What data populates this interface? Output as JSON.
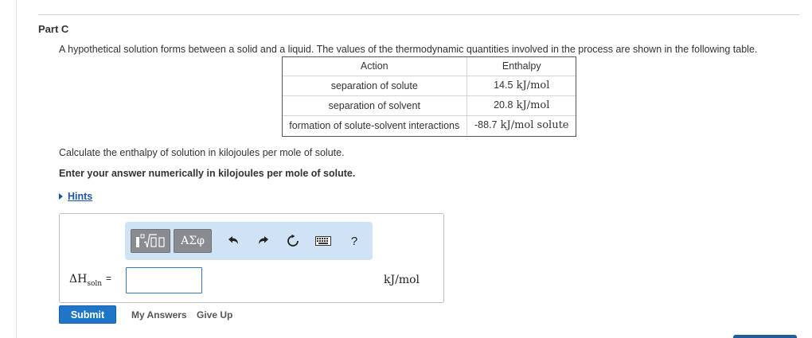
{
  "part": {
    "title": "Part C"
  },
  "problem": {
    "intro": "A hypothetical solution forms between a solid and a liquid. The values of the thermodynamic quantities involved in the process are shown in the following table.",
    "question": "Calculate the enthalpy of solution in kilojoules per mole of solute.",
    "instruction": "Enter your answer numerically in kilojoules per mole of solute."
  },
  "table": {
    "headers": {
      "action": "Action",
      "enthalpy": "Enthalpy"
    },
    "rows": [
      {
        "action": "separation of solute",
        "value": "14.5",
        "unit": "kJ/mol"
      },
      {
        "action": "separation of solvent",
        "value": "20.8",
        "unit": "kJ/mol"
      },
      {
        "action": "formation of solute-solvent interactions",
        "value": "-88.7",
        "unit": "kJ/mol solute"
      }
    ]
  },
  "hints": {
    "label": "Hints"
  },
  "toolbar": {
    "greek_label": "ΑΣφ",
    "icons": [
      "template-icon",
      "greek-symbols-icon",
      "undo-icon",
      "redo-icon",
      "reset-icon",
      "keyboard-icon",
      "help-icon"
    ],
    "help_label": "?"
  },
  "answer": {
    "label_main": "ΔH",
    "label_sub": "soln",
    "label_eq": "=",
    "value": "",
    "unit": "kJ/mol"
  },
  "actions": {
    "submit": "Submit",
    "my_answers": "My Answers",
    "give_up": "Give Up"
  },
  "colors": {
    "link": "#1a56a8",
    "submit": "#1f76c9",
    "toolbar_bg": "#d0e3f5",
    "toolbar_button": "#888b90",
    "input_border": "#3b74c5"
  }
}
